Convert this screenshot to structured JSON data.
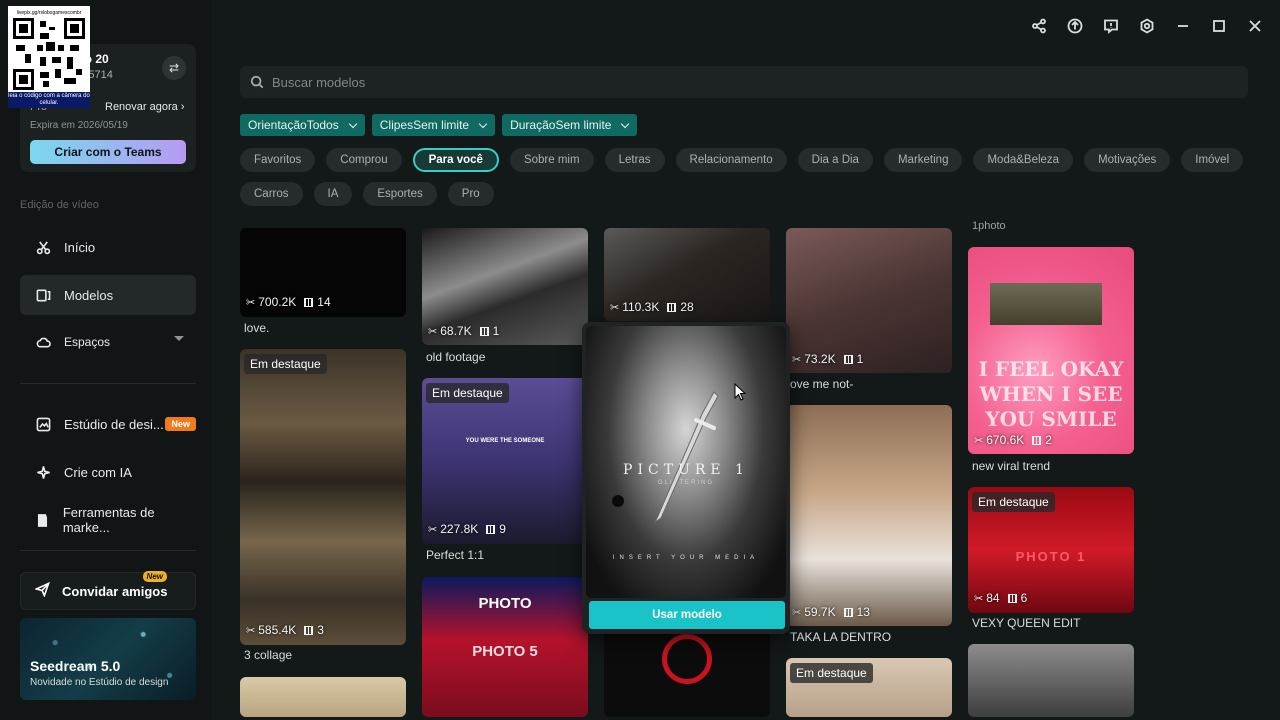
{
  "window": {
    "share_icon": "share-icon",
    "upload_icon": "upload-icon",
    "feedback_icon": "feedback-icon",
    "settings_icon": "settings-icon"
  },
  "qr": {
    "top_text": "livepix.gg/rslobogamescombr",
    "bottom_text": "leia o código com a câmera do celular."
  },
  "account": {
    "name": "obo 20",
    "id": "0365714",
    "plan": "Pro",
    "renew": "Renovar agora",
    "expires": "Expira em 2026/05/19",
    "teams_button": "Criar com o Teams"
  },
  "sidebar": {
    "section": "Edição de vídeo",
    "items": [
      {
        "label": "Início",
        "icon": "scissors-icon"
      },
      {
        "label": "Modelos",
        "icon": "templates-icon"
      },
      {
        "label": "Espaços",
        "icon": "cloud-icon"
      },
      {
        "label": "Estúdio de desi...",
        "icon": "design-icon",
        "badge": "New"
      },
      {
        "label": "Crie com IA",
        "icon": "sparkle-icon"
      },
      {
        "label": "Ferramentas de marke...",
        "icon": "marketing-icon"
      }
    ],
    "invite": {
      "label": "Convidar amigos",
      "badge": "New"
    },
    "promo": {
      "title": "Seedream 5.0",
      "subtitle": "Novidade no Estúdio de design"
    }
  },
  "search": {
    "placeholder": "Buscar modelos"
  },
  "filters": [
    {
      "label": "OrientaçãoTodos"
    },
    {
      "label": "ClipesSem limite"
    },
    {
      "label": "DuraçãoSem limite"
    }
  ],
  "chips": [
    {
      "label": "Favoritos",
      "active": false
    },
    {
      "label": "Comprou",
      "active": false
    },
    {
      "label": "Para você",
      "active": true
    },
    {
      "label": "Sobre mim",
      "active": false
    },
    {
      "label": "Letras",
      "active": false
    },
    {
      "label": "Relacionamento",
      "active": false
    },
    {
      "label": "Dia a Dia",
      "active": false
    },
    {
      "label": "Marketing",
      "active": false
    },
    {
      "label": "Moda&Beleza",
      "active": false
    },
    {
      "label": "Motivações",
      "active": false
    },
    {
      "label": "Imóvel",
      "active": false
    },
    {
      "label": "Carros",
      "active": false
    },
    {
      "label": "IA",
      "active": false
    },
    {
      "label": "Esportes",
      "active": false
    },
    {
      "label": "Pro",
      "active": false
    }
  ],
  "cards": {
    "c1": {
      "uses": "700.2K",
      "clips": "14",
      "caption": "love."
    },
    "c2": {
      "uses": "68.7K",
      "clips": "1",
      "caption": "old footage"
    },
    "c3": {
      "uses": "110.3K",
      "clips": "28",
      "caption": ""
    },
    "c4": {
      "uses": "73.2K",
      "clips": "1",
      "caption": "ove me not-"
    },
    "c5_top_caption": "1photo",
    "c5": {
      "uses": "670.6K",
      "clips": "2",
      "caption": "new viral trend",
      "overlay": "I FEEL OKAY WHEN I SEE YOU SMILE"
    },
    "c6": {
      "uses": "585.4K",
      "clips": "3",
      "caption": "3 collage",
      "badge": "Em destaque"
    },
    "c7": {
      "uses": "227.8K",
      "clips": "9",
      "caption": "Perfect 1:1",
      "badge": "Em destaque",
      "overlay": "YOU WERE THE SOMEONE"
    },
    "c8": {
      "uses": "59.7K",
      "clips": "13",
      "caption": "TAKA LA DENTRO"
    },
    "c9": {
      "uses": "84",
      "clips": "6",
      "caption": "VEXY QUEEN EDIT",
      "badge": "Em destaque",
      "overlay": "PHOTO 1"
    },
    "c10": {
      "overlay1": "PHOTO",
      "overlay2": "PHOTO 5"
    },
    "c11": {
      "badge": "Em destaque"
    }
  },
  "popup": {
    "title": "PICTURE 1",
    "subtitle": "GLITTERING",
    "insert": "INSERT YOUR MEDIA",
    "button": "Usar modelo"
  }
}
